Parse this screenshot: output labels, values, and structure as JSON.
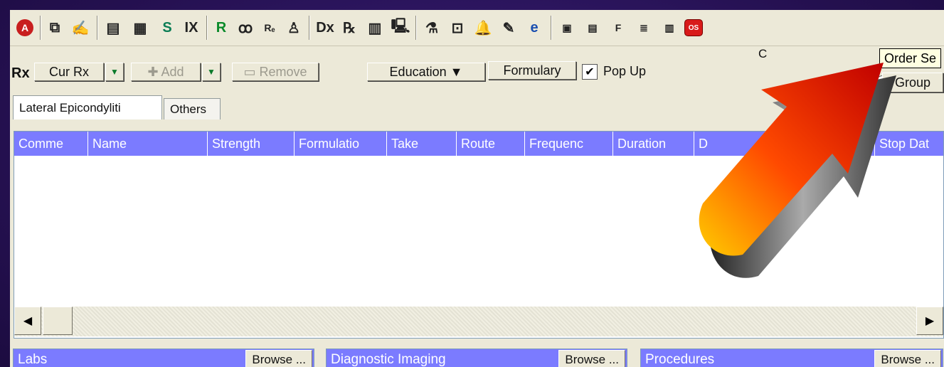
{
  "toolbar": {
    "icons": [
      {
        "name": "stop-icon",
        "glyph": "A"
      },
      {
        "name": "copy-icon",
        "glyph": "⧉"
      },
      {
        "name": "signature-icon",
        "glyph": "✍"
      },
      {
        "name": "note-icon",
        "glyph": "▤"
      },
      {
        "name": "chart-icon",
        "glyph": "▦"
      },
      {
        "name": "s-icon",
        "glyph": "S"
      },
      {
        "name": "ix-icon",
        "glyph": "IX"
      },
      {
        "name": "r-icon",
        "glyph": "R"
      },
      {
        "name": "glasses-icon",
        "glyph": "ꝏ"
      },
      {
        "name": "re-icon",
        "glyph": "Rₑ"
      },
      {
        "name": "person-icon",
        "glyph": "♙"
      },
      {
        "name": "dx-icon",
        "glyph": "Dx"
      },
      {
        "name": "rx-pad-icon",
        "glyph": "℞"
      },
      {
        "name": "calendar-icon",
        "glyph": "▥"
      },
      {
        "name": "monitor-icon",
        "glyph": "🖳"
      },
      {
        "name": "bio-icon",
        "glyph": "⚗"
      },
      {
        "name": "lock-icon",
        "glyph": "⊡"
      },
      {
        "name": "bell-icon",
        "glyph": "🔔"
      },
      {
        "name": "pen-icon",
        "glyph": "✎"
      },
      {
        "name": "browser-icon",
        "glyph": "e"
      },
      {
        "name": "form-icon",
        "glyph": "▣"
      },
      {
        "name": "text-icon",
        "glyph": "▤"
      },
      {
        "name": "fax-icon",
        "glyph": "F"
      },
      {
        "name": "list-icon",
        "glyph": "≣"
      },
      {
        "name": "book-icon",
        "glyph": "▥"
      },
      {
        "name": "order-sets-icon",
        "glyph": "OS"
      }
    ],
    "tooltip": "Order Se"
  },
  "rx": {
    "label": "Rx",
    "cur_rx": "Cur Rx",
    "add": "✚ Add",
    "remove": "▭ Remove",
    "education": "Education ▼",
    "formulary": "Formulary",
    "popup_checked": "✔",
    "popup_label": "Pop Up",
    "partial_top": "C",
    "group": "Group"
  },
  "tabs": [
    {
      "label": "Lateral Epicondyliti"
    },
    {
      "label": "Others"
    }
  ],
  "grid": {
    "columns": [
      "Comme",
      "Name",
      "Strength",
      "Formulatio",
      "Take",
      "Route",
      "Frequenc",
      "Duration",
      "D",
      "",
      "Stop Dat"
    ]
  },
  "panels": [
    {
      "title": "Labs",
      "browse": "Browse ..."
    },
    {
      "title": "Diagnostic Imaging",
      "browse": "Browse ..."
    },
    {
      "title": "Procedures",
      "browse": "Browse ..."
    }
  ],
  "scroll": {
    "left": "◀",
    "right": "▶"
  },
  "colors": {
    "grid_header": "#7b7bff",
    "arrow_start": "#ffcc00",
    "arrow_end": "#c00000"
  }
}
